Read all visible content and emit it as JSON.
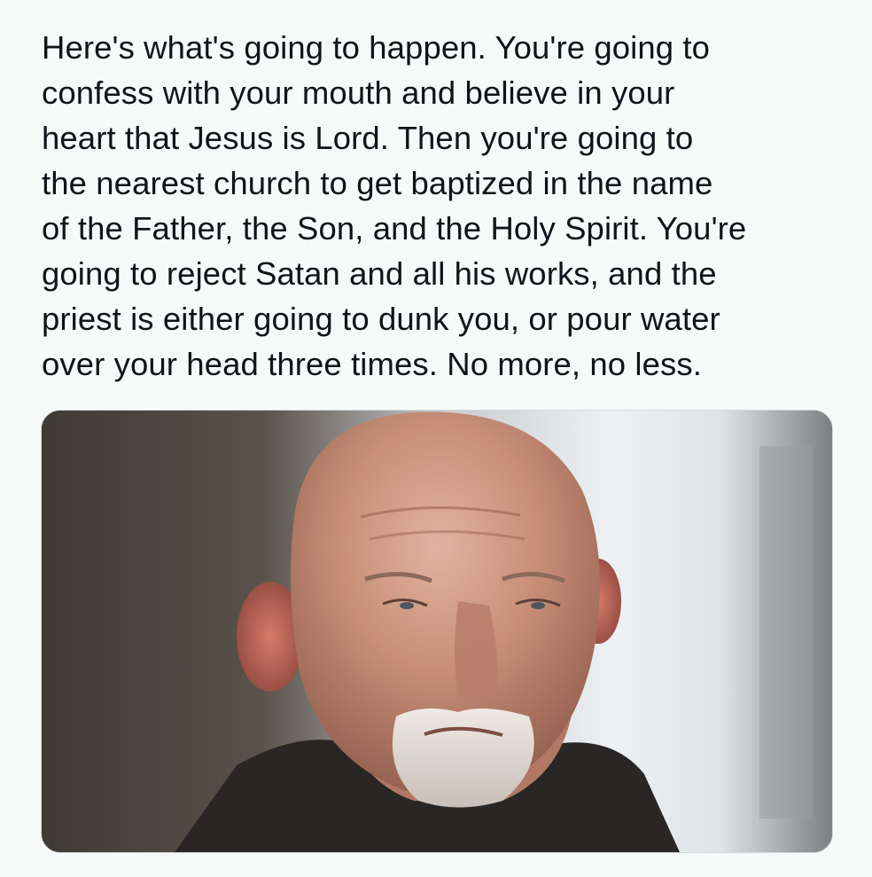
{
  "post": {
    "text_lines": [
      "Here's what's going to happen. You're going to",
      "confess with your mouth and believe in your",
      "heart that Jesus is Lord. Then you're going to",
      "the nearest church to get baptized in the name",
      "of the Father, the Son, and the Holy Spirit. You're",
      "going to reject Satan and all his works, and the",
      "priest is either going to dunk you, or pour water",
      "over your head three times. No more, no less."
    ]
  },
  "media": {
    "kind": "photo",
    "subject": "portrait-photo",
    "colors": {
      "skin": "#c98f78",
      "skin_shadow": "#8e5a4a",
      "background_light": "#e9ecee",
      "background_dark": "#4a443f",
      "beard": "#e6e1dc",
      "jacket": "#2a2625"
    }
  }
}
